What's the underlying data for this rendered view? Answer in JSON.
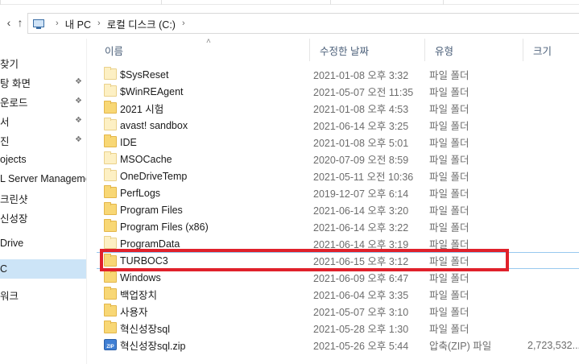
{
  "top_tabs": [
    "",
    "",
    "",
    ""
  ],
  "address": {
    "crumbs": [
      "내 PC",
      "로컬 디스크 (C:)"
    ],
    "back_icon": "back-arrow-icon",
    "up_icon": "up-arrow-icon"
  },
  "sidebar": {
    "items": [
      {
        "label": "찾기",
        "pinned": false
      },
      {
        "label": "탕 화면",
        "pinned": true
      },
      {
        "label": "운로드",
        "pinned": true
      },
      {
        "label": "서",
        "pinned": true
      },
      {
        "label": "진",
        "pinned": true
      },
      {
        "label": "ojects",
        "pinned": false
      },
      {
        "label": "L Server Manageme",
        "pinned": false
      },
      {
        "label": "크린샷",
        "pinned": false
      },
      {
        "label": "신성장",
        "pinned": false
      },
      {
        "label": "Drive",
        "pinned": false
      },
      {
        "label": "C",
        "pinned": false
      },
      {
        "label": "워크",
        "pinned": false
      }
    ]
  },
  "columns": {
    "name": "이름",
    "date": "수정한 날짜",
    "type": "유형",
    "size": "크기"
  },
  "files": [
    {
      "name": "$SysReset",
      "date": "2021-01-08 오후 3:32",
      "type": "파일 폴더",
      "size": "",
      "icon": "folder-light"
    },
    {
      "name": "$WinREAgent",
      "date": "2021-05-07 오전 11:35",
      "type": "파일 폴더",
      "size": "",
      "icon": "folder-light"
    },
    {
      "name": "2021 시험",
      "date": "2021-01-08 오후 4:53",
      "type": "파일 폴더",
      "size": "",
      "icon": "folder"
    },
    {
      "name": "avast! sandbox",
      "date": "2021-06-14 오후 3:25",
      "type": "파일 폴더",
      "size": "",
      "icon": "folder-light"
    },
    {
      "name": "IDE",
      "date": "2021-01-08 오후 5:01",
      "type": "파일 폴더",
      "size": "",
      "icon": "folder"
    },
    {
      "name": "MSOCache",
      "date": "2020-07-09 오전 8:59",
      "type": "파일 폴더",
      "size": "",
      "icon": "folder-light"
    },
    {
      "name": "OneDriveTemp",
      "date": "2021-05-11 오전 10:36",
      "type": "파일 폴더",
      "size": "",
      "icon": "folder-light"
    },
    {
      "name": "PerfLogs",
      "date": "2019-12-07 오후 6:14",
      "type": "파일 폴더",
      "size": "",
      "icon": "folder"
    },
    {
      "name": "Program Files",
      "date": "2021-06-14 오후 3:20",
      "type": "파일 폴더",
      "size": "",
      "icon": "folder"
    },
    {
      "name": "Program Files (x86)",
      "date": "2021-06-14 오후 3:22",
      "type": "파일 폴더",
      "size": "",
      "icon": "folder"
    },
    {
      "name": "ProgramData",
      "date": "2021-06-14 오후 3:19",
      "type": "파일 폴더",
      "size": "",
      "icon": "folder-light"
    },
    {
      "name": "TURBOC3",
      "date": "2021-06-15 오후 3:12",
      "type": "파일 폴더",
      "size": "",
      "icon": "folder"
    },
    {
      "name": "Windows",
      "date": "2021-06-09 오후 6:47",
      "type": "파일 폴더",
      "size": "",
      "icon": "folder"
    },
    {
      "name": "백업장치",
      "date": "2021-06-04 오후 3:35",
      "type": "파일 폴더",
      "size": "",
      "icon": "folder"
    },
    {
      "name": "사용자",
      "date": "2021-05-07 오후 3:10",
      "type": "파일 폴더",
      "size": "",
      "icon": "folder"
    },
    {
      "name": "혁신성장sql",
      "date": "2021-05-28 오후 1:30",
      "type": "파일 폴더",
      "size": "",
      "icon": "folder"
    },
    {
      "name": "혁신성장sql.zip",
      "date": "2021-05-26 오후 5:44",
      "type": "압축(ZIP) 파일",
      "size": "2,723,532...",
      "icon": "zip"
    }
  ],
  "zip_icon_text": "ZIP",
  "highlighted_file": "TURBOC3",
  "highlight_color": "#e0212b"
}
